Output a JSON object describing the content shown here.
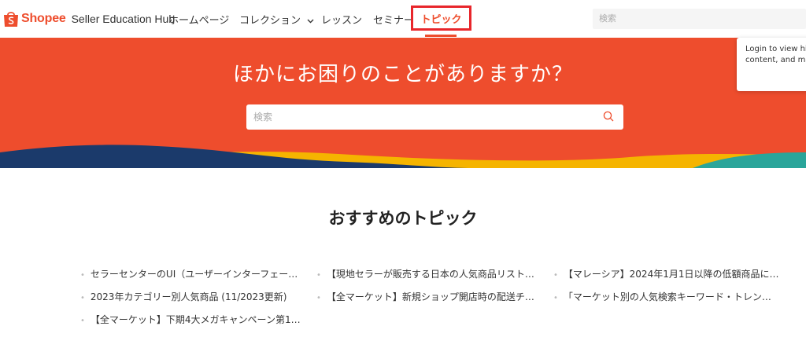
{
  "brand": {
    "logo_word": "Shopee",
    "subtitle": "Seller Education Hub",
    "color": "#ee4d2d",
    "logo_icon": "shopping-bag-icon"
  },
  "nav": {
    "home": "ホームページ",
    "collection": "コレクション",
    "lessons": "レッスン",
    "seminar": "セミナー",
    "topics": "トピック",
    "search_placeholder": "検索"
  },
  "login_tooltip": {
    "line1": "Login to view his",
    "line2": "content, and mo"
  },
  "hero": {
    "title": "ほかにお困りのことがありますか？",
    "search_placeholder": "検索",
    "search_icon": "search-icon",
    "wave_colors": [
      "#1b3a6b",
      "#f5b400",
      "#2aa59a"
    ]
  },
  "recommended": {
    "title": "おすすめのトピック",
    "topics": [
      "セラーセンターのUI（ユーザーインターフェー…",
      "【現地セラーが販売する日本の人気商品リスト…",
      "【マレーシア】2024年1月1日以降の低額商品に…",
      "2023年カテゴリー別人気商品 (11/2023更新)",
      "【全マーケット】新規ショップ開店時の配送チ…",
      "「マーケット別の人気検索キーワード・トレン…",
      "【全マーケット】下期4大メガキャンペーン第1…"
    ]
  }
}
